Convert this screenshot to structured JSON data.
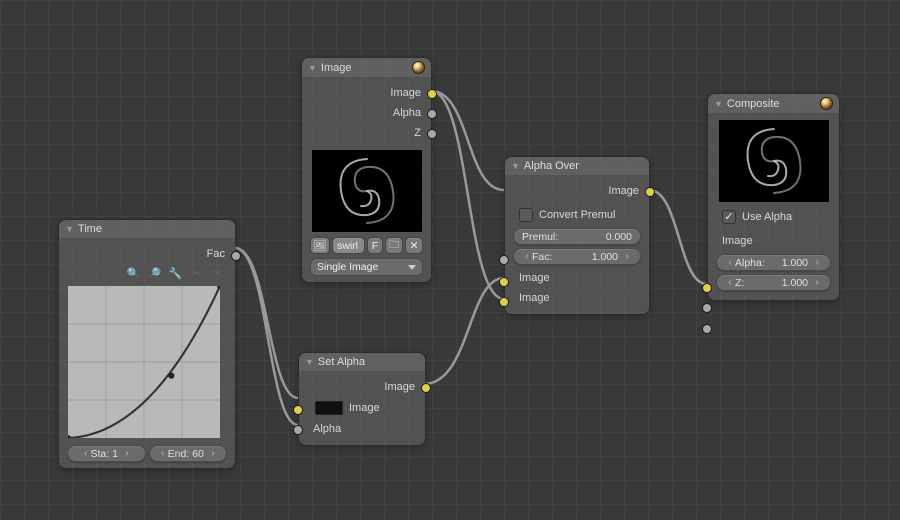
{
  "nodes": {
    "time": {
      "title": "Time",
      "outputs": {
        "fac": "Fac"
      },
      "fields": {
        "sta_l": "Sta:",
        "sta_v": "1",
        "end_l": "End:",
        "end_v": "60"
      },
      "tools": {
        "zoom_in": "zoom-in-icon",
        "zoom_out": "zoom-out-icon",
        "wrench": "wrench-icon",
        "clip": "clip-icon",
        "delete": "close-icon"
      }
    },
    "image": {
      "title": "Image",
      "outputs": {
        "image": "Image",
        "alpha": "Alpha",
        "z": "Z"
      },
      "buttons": {
        "browse": "image-browse-icon",
        "name": "swirl",
        "fake": "F",
        "pack": "pack-icon",
        "del": "✕"
      },
      "menu": "Single Image"
    },
    "setalpha": {
      "title": "Set Alpha",
      "outputs": {
        "image": "Image"
      },
      "inputs": {
        "image": "Image",
        "alpha": "Alpha"
      }
    },
    "alphaover": {
      "title": "Alpha Over",
      "outputs": {
        "image": "Image"
      },
      "fields": {
        "convert": "Convert Premul",
        "premul_l": "Premul:",
        "premul_v": "0.000",
        "fac_l": "Fac:",
        "fac_v": "1.000"
      },
      "inputs": {
        "image1": "Image",
        "image2": "Image"
      }
    },
    "composite": {
      "title": "Composite",
      "fields": {
        "usealpha": "Use Alpha",
        "alpha_l": "Alpha:",
        "alpha_v": "1.000",
        "z_l": "Z:",
        "z_v": "1.000"
      },
      "inputs": {
        "image": "Image"
      }
    }
  }
}
